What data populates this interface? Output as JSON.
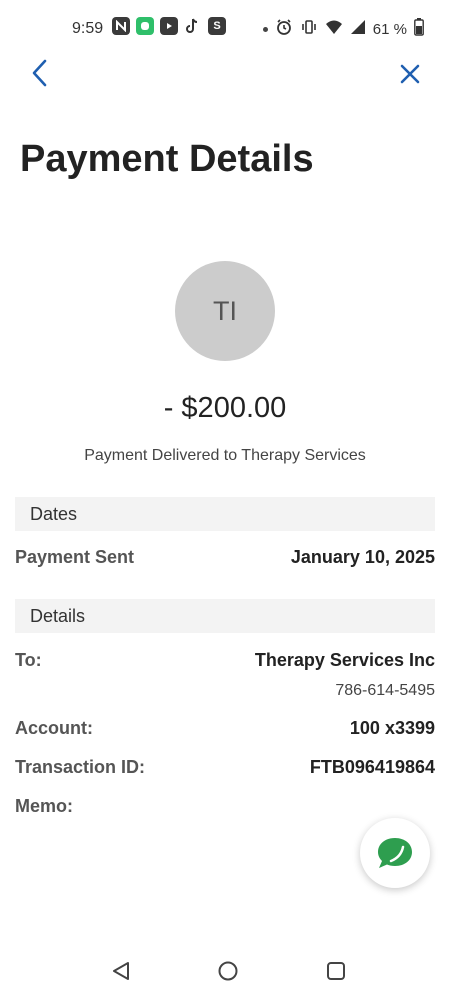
{
  "status_bar": {
    "time": "9:59",
    "battery": "61 %",
    "app_s_letter": "S"
  },
  "header": {
    "title": "Payment Details"
  },
  "payment": {
    "avatar_initials": "TI",
    "amount": "- $200.00",
    "status": "Payment Delivered to Therapy Services"
  },
  "dates": {
    "section_label": "Dates",
    "payment_sent_label": "Payment Sent",
    "payment_sent_value": "January 10, 2025"
  },
  "details": {
    "section_label": "Details",
    "to_label": "To:",
    "to_value": "Therapy Services Inc",
    "to_phone": "786-614-5495",
    "account_label": "Account:",
    "account_value": "100 x3399",
    "transaction_label": "Transaction ID:",
    "transaction_value": "FTB096419864",
    "memo_label": "Memo:"
  },
  "colors": {
    "accent": "#1f5fb0",
    "chat_green": "#2e9e4f",
    "section_bg": "#f3f3f3",
    "avatar_bg": "#cccccc"
  }
}
